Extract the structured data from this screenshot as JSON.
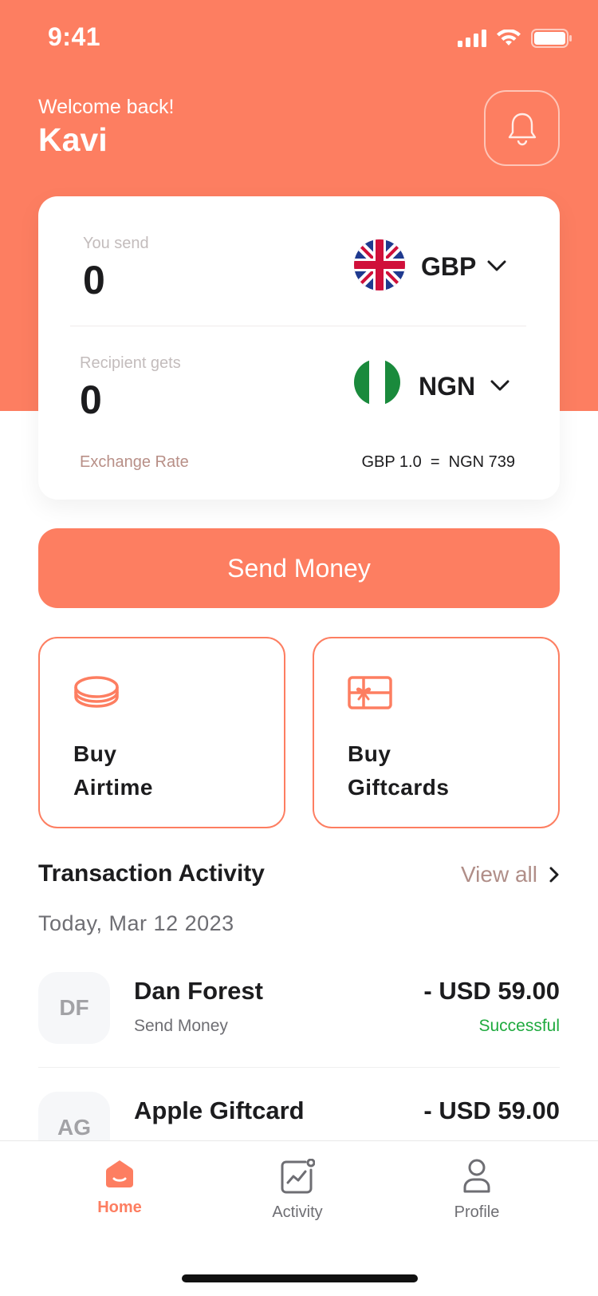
{
  "status_bar": {
    "time": "9:41"
  },
  "header": {
    "welcome": "Welcome back!",
    "username": "Kavi"
  },
  "converter": {
    "send": {
      "label": "You send",
      "amount": "0",
      "currency": "GBP"
    },
    "receive": {
      "label": "Recipient gets",
      "amount": "0",
      "currency": "NGN"
    },
    "exchange_rate": {
      "label": "Exchange Rate",
      "value": "GBP 1.0  =  NGN 739"
    }
  },
  "send_button": {
    "label": "Send Money"
  },
  "actions": [
    {
      "line1": "Buy",
      "line2": "Airtime",
      "icon": "coin-icon"
    },
    {
      "line1": "Buy",
      "line2": "Giftcards",
      "icon": "gift-card-icon"
    }
  ],
  "activity": {
    "title": "Transaction Activity",
    "view_all": "View all",
    "date": "Today, Mar 12 2023",
    "transactions": [
      {
        "initials": "DF",
        "name": "Dan Forest",
        "type": "Send Money",
        "amount": "- USD 59.00",
        "status": "Successful"
      },
      {
        "initials": "AG",
        "name": "Apple Giftcard",
        "amount": "- USD 59.00"
      }
    ]
  },
  "tabs": [
    {
      "label": "Home",
      "icon": "home-icon",
      "active": true
    },
    {
      "label": "Activity",
      "icon": "activity-icon",
      "active": false
    },
    {
      "label": "Profile",
      "icon": "profile-icon",
      "active": false
    }
  ],
  "colors": {
    "accent": "#fd7e61",
    "success": "#1faa3f",
    "muted": "#b08e88"
  }
}
